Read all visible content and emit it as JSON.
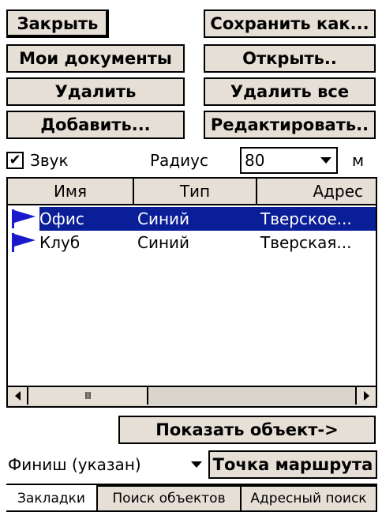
{
  "buttons": {
    "close": "Закрыть",
    "save_as": "Сохранить как...",
    "my_docs": "Мои документы",
    "open": "Открыть..",
    "delete": "Удалить",
    "delete_all": "Удалить все",
    "add": "Добавить...",
    "edit": "Редактировать..",
    "show_object": "Показать объект->",
    "route_point": "Точка маршрута"
  },
  "sound": {
    "label": "Звук",
    "checked": true,
    "check_glyph": "✔"
  },
  "radius": {
    "label": "Радиус",
    "value": "80",
    "unit": "м"
  },
  "list": {
    "columns": [
      "Имя",
      "Тип",
      "Адрес"
    ],
    "rows": [
      {
        "name": "Офис",
        "type": "Синий",
        "address": "Тверское...",
        "selected": true,
        "icon": "blue-flag-icon"
      },
      {
        "name": "Клуб",
        "type": "Синий",
        "address": "Тверская...",
        "selected": false,
        "icon": "blue-flag-icon"
      }
    ],
    "scroll_thumb_glyph": "III"
  },
  "finish": {
    "value": "Финиш (указан)"
  },
  "tabs": [
    {
      "label": "Закладки",
      "active": true
    },
    {
      "label": "Поиск объектов",
      "active": false
    },
    {
      "label": "Адресный поиск",
      "active": false
    }
  ],
  "colors": {
    "selection": "#0a1e97",
    "button_face": "#e5dfd5",
    "flag": "#1a1acc"
  }
}
